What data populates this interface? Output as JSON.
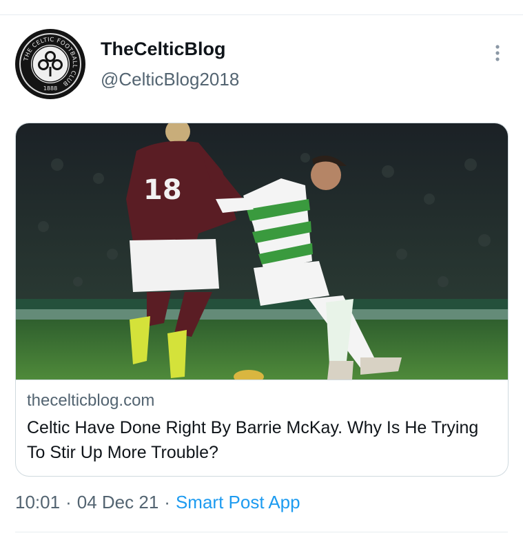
{
  "author": {
    "display_name": "TheCelticBlog",
    "handle": "@CelticBlog2018",
    "avatar_icon": "celtic-crest-icon",
    "avatar_ring_text": "THE CELTIC FOOTBALL CLUB",
    "avatar_year": "1888"
  },
  "link_card": {
    "image_icon": "football-match-photo",
    "domain": "thecelticblog.com",
    "title": "Celtic Have Done Right By Barrie McKay. Why Is He Trying To Stir Up More Trouble?"
  },
  "meta": {
    "time": "10:01",
    "date": "04 Dec 21",
    "separator": "·",
    "source": "Smart Post App"
  },
  "colors": {
    "link_blue": "#1d9bf0",
    "secondary_text": "#536471",
    "border": "#cfd9de"
  }
}
